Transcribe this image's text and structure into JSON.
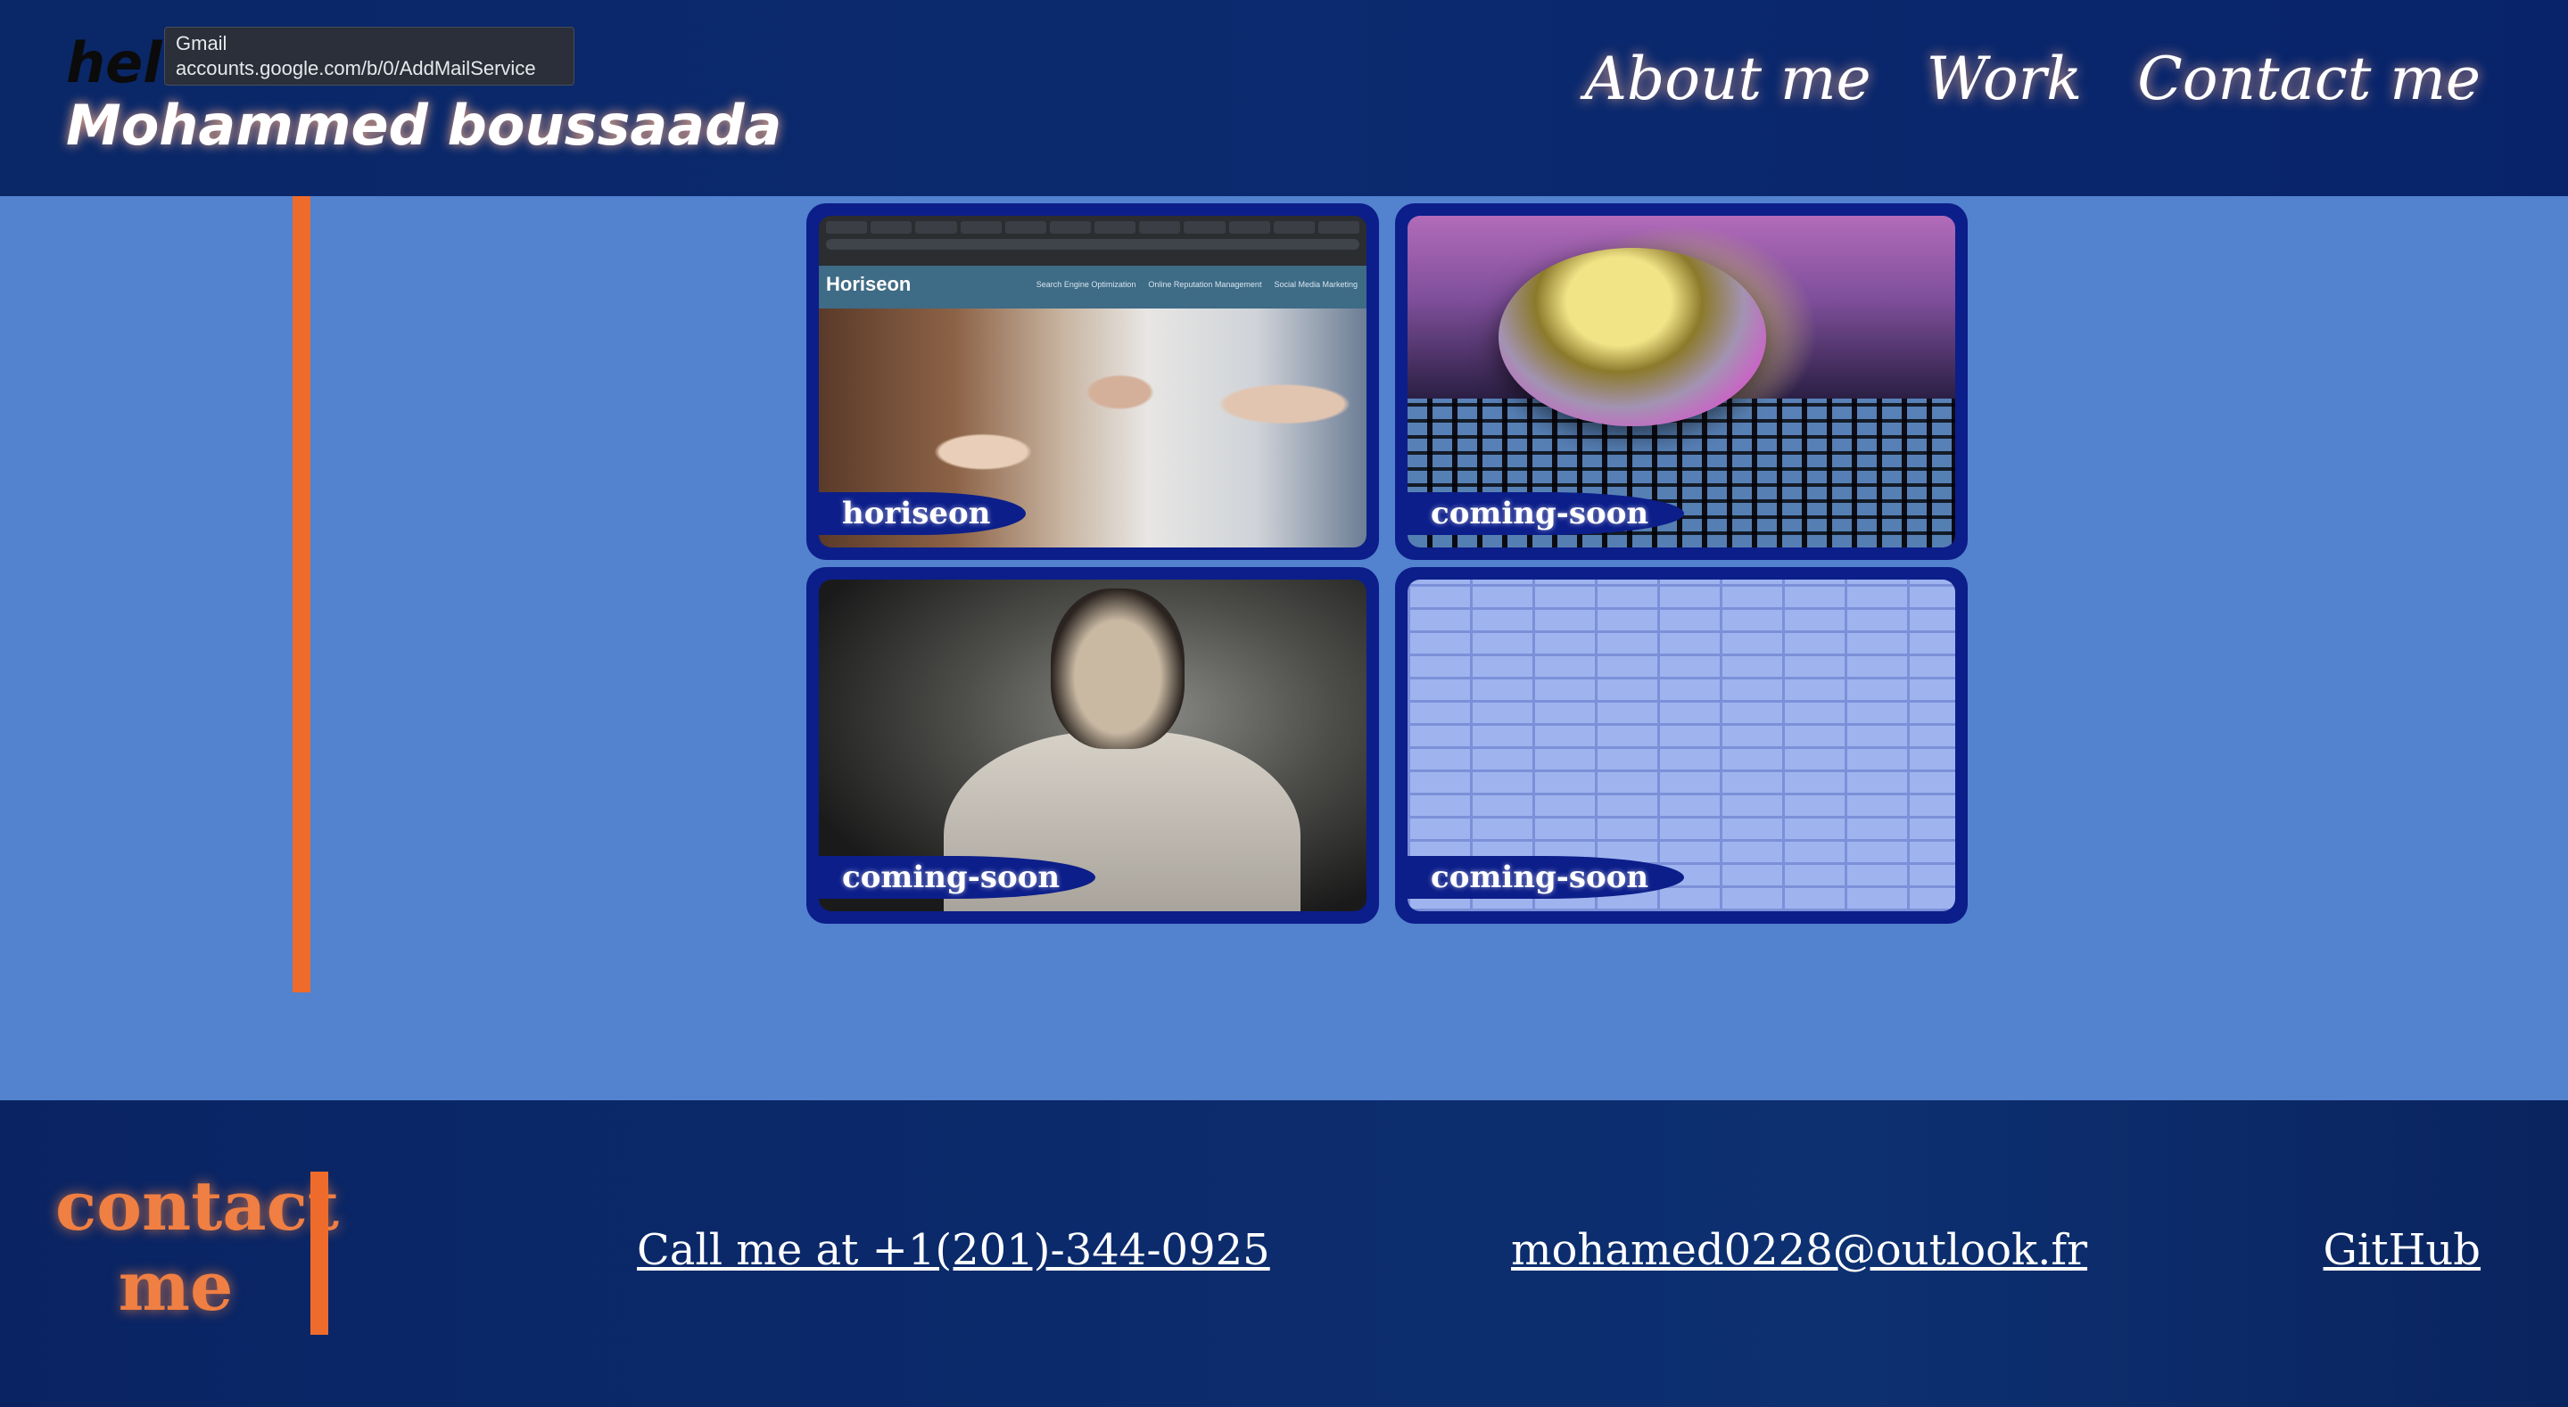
{
  "header": {
    "hello": "hello",
    "name": "Mohammed boussaada",
    "tooltip": {
      "title": "Gmail",
      "url": "accounts.google.com/b/0/AddMailService"
    },
    "nav": [
      "About me",
      "Work",
      "Contact me"
    ]
  },
  "gallery": {
    "cards": [
      {
        "label": "horiseon",
        "preview_brand": "Horiseon",
        "preview_links": [
          "Search Engine Optimization",
          "Online Reputation Management",
          "Social Media Marketing"
        ]
      },
      {
        "label": "coming-soon"
      },
      {
        "label": "coming-soon"
      },
      {
        "label": "coming-soon"
      }
    ]
  },
  "footer": {
    "heading": "contact me",
    "phone": "Call me at +1(201)-344-0925",
    "email": "mohamed0228@outlook.fr",
    "github": "GitHub"
  },
  "colors": {
    "background": "#5382cf",
    "header": "#0a2767",
    "accent": "#ef6b2b",
    "card_frame": "#0c1e8a"
  }
}
